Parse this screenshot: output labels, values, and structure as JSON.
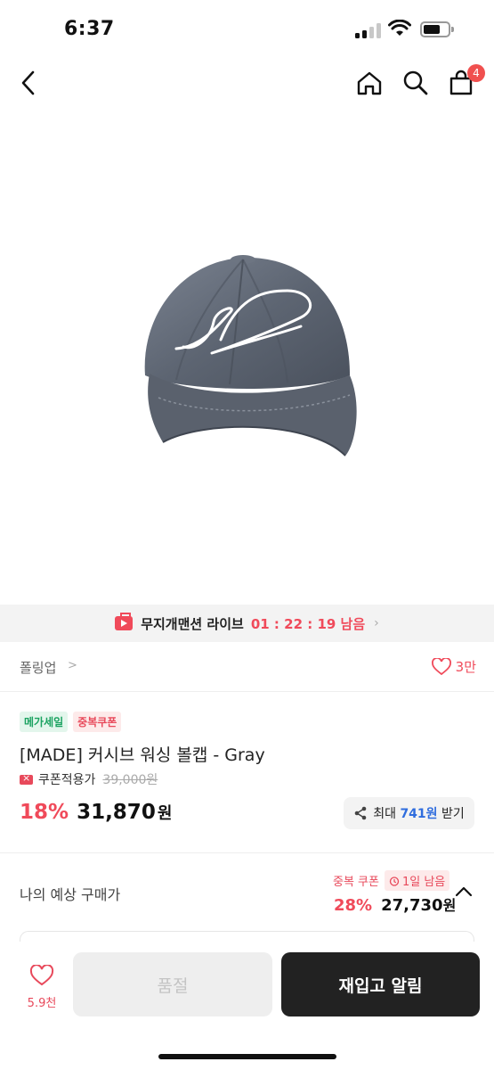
{
  "status_bar": {
    "time": "6:37"
  },
  "nav": {
    "back_icon": "chevron-left-icon",
    "home_icon": "home-icon",
    "search_icon": "search-icon",
    "cart_icon": "shopping-bag-icon",
    "cart_count": "4"
  },
  "product_image": {
    "description_icon": "gray-cap-image"
  },
  "live_banner": {
    "label": "무지개맨션 라이브",
    "countdown": "01 : 22 : 19 남음",
    "chevron": "›"
  },
  "brand": {
    "name": "폴링업",
    "chevron": ">",
    "likes": "3만"
  },
  "badges": [
    "메가세일",
    "중복쿠폰"
  ],
  "product": {
    "title": "[MADE] 커시브 워싱 볼캡  - Gray",
    "coupon_label": "쿠폰적용가",
    "original_price": "39,000원",
    "discount": "18%",
    "price": "31,870",
    "won": "원"
  },
  "max_coupon": {
    "prefix": "최대",
    "amount": "741원",
    "suffix": "받기"
  },
  "expected": {
    "label": "나의 예상 구매가",
    "tag_dup": "중복 쿠폰",
    "tag_time": "1일 남음",
    "discount": "28%",
    "price": "27,730",
    "won": "원"
  },
  "bottom": {
    "fav_count": "5.9천",
    "soldout_label": "품절",
    "restock_label": "재입고 알림"
  },
  "colors": {
    "accent_red": "#f04a5a",
    "blue": "#2f6dde",
    "green": "#1aa260",
    "dark": "#222222"
  }
}
